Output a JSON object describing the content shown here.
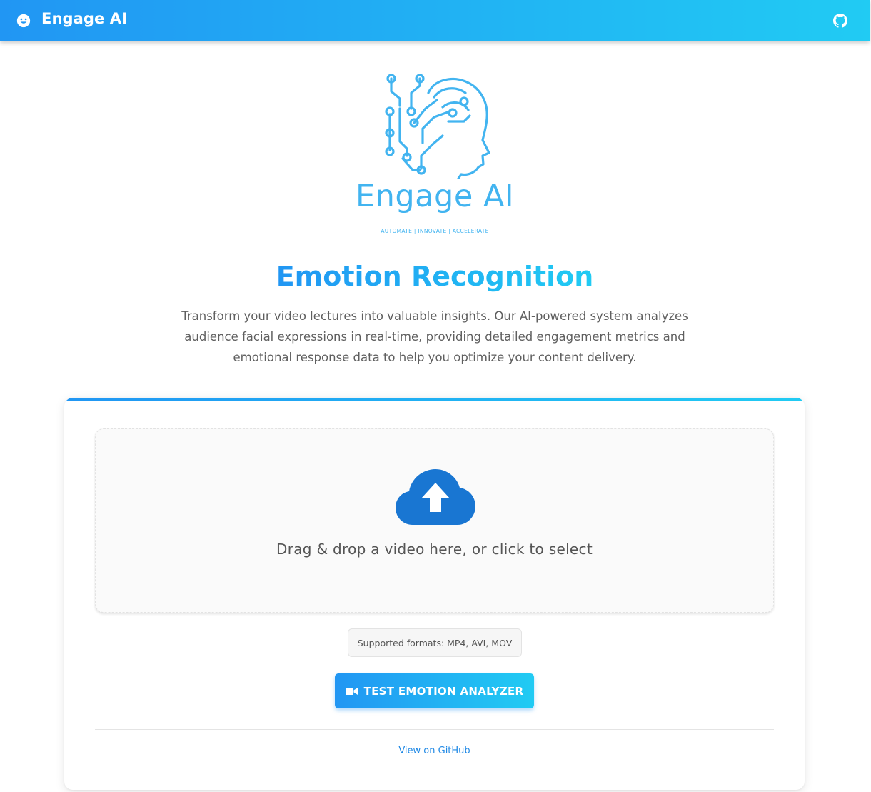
{
  "appbar": {
    "brand_icon": "smiley-face-icon",
    "title": "Engage AI",
    "github_icon": "github-icon"
  },
  "hero": {
    "logo": {
      "icon": "ai-head-circuit-icon",
      "wordmark": "Engage AI",
      "tagline": "AUTOMATE | INNOVATE | ACCELERATE"
    },
    "title": "Emotion Recognition",
    "intro": "Transform your video lectures into valuable insights. Our AI-powered system analyzes audience facial expressions in real-time, providing detailed engagement metrics and emotional response data to help you optimize your content delivery."
  },
  "upload": {
    "icon": "cloud-upload-icon",
    "prompt": "Drag & drop a video here, or click to select",
    "formats": "Supported formats: MP4, AVI, MOV"
  },
  "actions": {
    "test_button_icon": "videocam-icon",
    "test_button_label": "TEST EMOTION ANALYZER",
    "github_link": "View on GitHub"
  },
  "colors": {
    "gradient_start": "#2196f3",
    "gradient_end": "#21cbf3",
    "upload_icon": "#1976d2",
    "logo": "#42b4f0",
    "link": "#1e88e5"
  }
}
